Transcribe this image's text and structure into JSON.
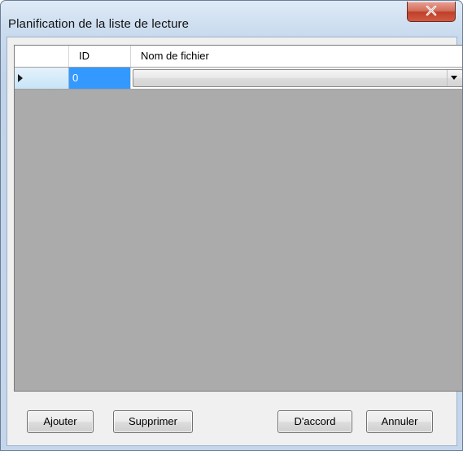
{
  "window": {
    "title": "Planification de la liste de lecture",
    "close_icon": "close-icon"
  },
  "grid": {
    "columns": [
      "ID",
      "Nom de fichier"
    ],
    "rows": [
      {
        "id": "0",
        "filename": "",
        "selected": true
      }
    ],
    "row_header_icon": "current-row-arrow-icon",
    "dropdown_icon": "chevron-down-icon"
  },
  "buttons": {
    "add": "Ajouter",
    "delete": "Supprimer",
    "ok": "D'accord",
    "cancel": "Annuler"
  },
  "colors": {
    "selection": "#3399ff",
    "grid_background": "#ababab",
    "close_button": "#c0402a"
  }
}
